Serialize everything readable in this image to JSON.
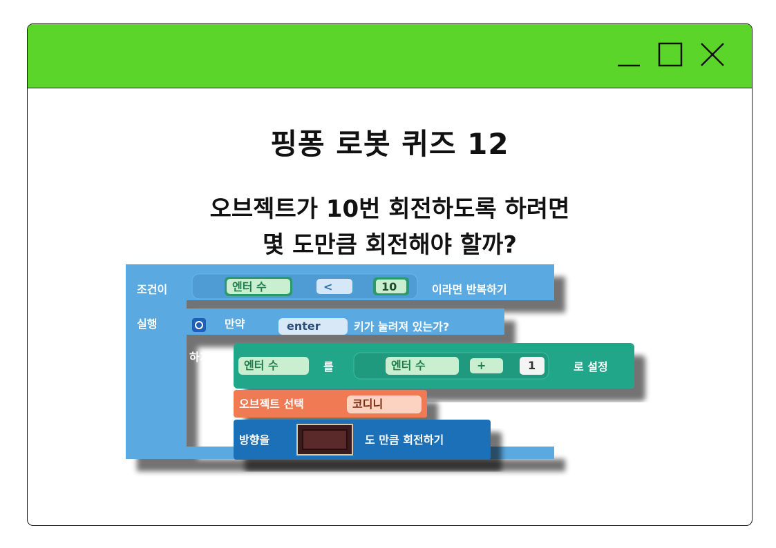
{
  "window": {
    "titlebar_color": "#5cd52b",
    "controls": {
      "minimize_icon": "minimize-icon",
      "maximize_icon": "maximize-icon",
      "close_icon": "close-icon"
    }
  },
  "title": "핑퐁 로봇 퀴즈 12",
  "question": {
    "line1": "오브젝트가 10번 회전하도록 하려면",
    "line2": "몇 도만큼 회전해야 할까?"
  },
  "code_blocks": {
    "repeat": {
      "label_condition": "조건이",
      "variable": "엔터 수",
      "operator": "<",
      "value": "10",
      "label_then": "이라면 반복하기",
      "label_run": "실행"
    },
    "if_block": {
      "label_if": "만약",
      "key": "enter",
      "label_condition": "키가 눌려져 있는가?",
      "label_do": "하기"
    },
    "set_var": {
      "variable": "엔터 수",
      "label_to": "를",
      "expr_variable": "엔터 수",
      "expr_operator": "+",
      "expr_value": "1",
      "label_end": "로 설정"
    },
    "select_object": {
      "label": "오브젝트 선택",
      "object": "코디니"
    },
    "rotate": {
      "label_direction": "방향을",
      "label_end": "도 만큼 회전하기"
    },
    "colors": {
      "control_blue": "#5aa9e0",
      "variable_teal": "#24a68a",
      "chip_green": "#c9efd0",
      "chip_green_text": "#1e7d4c",
      "object_orange": "#f07a52",
      "motion_blue": "#1f6fb8"
    }
  }
}
